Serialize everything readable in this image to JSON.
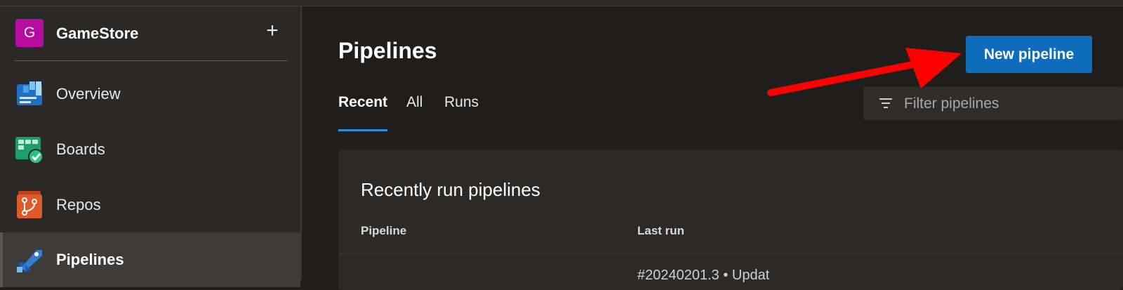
{
  "project": {
    "initial": "G",
    "name": "GameStore",
    "add_label": "+"
  },
  "sidebar": {
    "items": [
      {
        "label": "Overview",
        "icon": "overview-icon",
        "selected": false
      },
      {
        "label": "Boards",
        "icon": "boards-icon",
        "selected": false
      },
      {
        "label": "Repos",
        "icon": "repos-icon",
        "selected": false
      },
      {
        "label": "Pipelines",
        "icon": "pipelines-icon",
        "selected": true
      }
    ]
  },
  "main": {
    "title": "Pipelines",
    "new_button": "New pipeline",
    "tabs": [
      {
        "label": "Recent",
        "active": true
      },
      {
        "label": "All",
        "active": false
      },
      {
        "label": "Runs",
        "active": false
      }
    ],
    "filter_placeholder": "Filter pipelines",
    "card": {
      "title": "Recently run pipelines",
      "columns": [
        "Pipeline",
        "Last run"
      ],
      "first_row_last_run": "#20240201.3 • Updat"
    }
  },
  "colors": {
    "accent": "#0f6cbd",
    "project_avatar": "#b80ba0",
    "annotation_arrow": "#ff0000"
  }
}
